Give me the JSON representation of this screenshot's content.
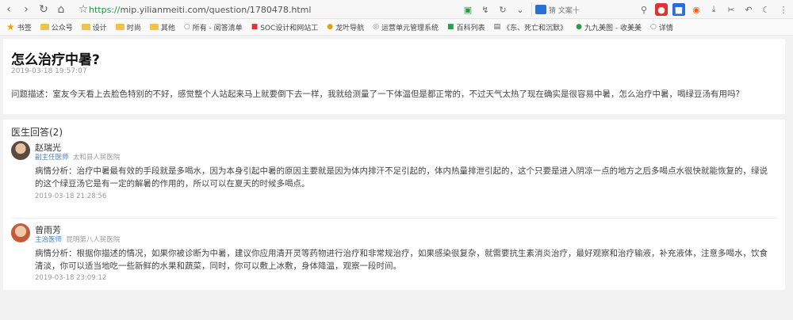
{
  "browser": {
    "url_scheme": "https://",
    "url_rest": "mip.yilianmeiti.com/question/1780478.html",
    "search_label": "猜 文案十"
  },
  "bookmarks": [
    {
      "label": "书签",
      "icon": "star-icon"
    },
    {
      "label": "公众号",
      "icon": "folder-icon"
    },
    {
      "label": "设计",
      "icon": "folder-icon"
    },
    {
      "label": "时尚",
      "icon": "folder-icon"
    },
    {
      "label": "其他",
      "icon": "folder-icon"
    },
    {
      "label": "所有 - 阅答清单",
      "icon": "page-icon"
    },
    {
      "label": "SOC设计和网站工",
      "icon": "page-icon"
    },
    {
      "label": "龙叶导航",
      "icon": "page-icon"
    },
    {
      "label": "运营单元管理系统",
      "icon": "page-icon"
    },
    {
      "label": "百科列表",
      "icon": "page-icon"
    },
    {
      "label": "《东、死亡和沉默》",
      "icon": "page-icon"
    },
    {
      "label": "九九美图 - 收美美",
      "icon": "page-icon"
    },
    {
      "label": "详情",
      "icon": "page-icon"
    }
  ],
  "question": {
    "title": "怎么治疗中暑?",
    "date": "2019-03-18 19:57:07",
    "body": "问题描述：室友今天看上去脸色特别的不好，感觉整个人站起来马上就要倒下去一样，我就给测量了一下体温但是都正常的，不过天气太热了现在确实是很容易中暑，怎么治疗中暑，喝绿豆汤有用吗?"
  },
  "answers_heading": "医生回答(2)",
  "answers": [
    {
      "doctor_name": "赵瑞光",
      "doctor_title": "副主任医师",
      "doctor_hospital": "太和县人民医院",
      "text": "病情分析：治疗中暑最有效的手段就是多喝水，因为本身引起中暑的原因主要就是因为体内排汗不足引起的，体内热量排泄引起的，这个只要是进入阴凉一点的地方之后多喝点水很快就能恢复的，绿说的这个绿豆汤它是有一定的解暑的作用的，所以可以在夏天的时候多喝点。",
      "time": "2019-03-18 21:28:56"
    },
    {
      "doctor_name": "曾雨芳",
      "doctor_title": "主治医师",
      "doctor_hospital": "昆明第八人民医院",
      "text": "病情分析：根据你描述的情况，如果你被诊断为中暑，建议你应用清开灵等药物进行治疗和非常规治疗，如果感染很复杂，就需要抗生素消炎治疗，最好观察和治疗输液，补充液体，注意多喝水，饮食清淡，你可以适当地吃一些新鲜的水果和蔬菜，同时，你可以敷上冰敷，身体降温，观察一段时间。",
      "time": "2019-03-18 23:09:12"
    }
  ]
}
